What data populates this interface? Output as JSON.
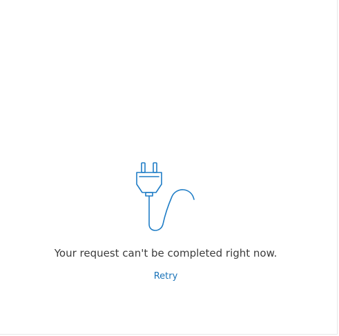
{
  "error_state": {
    "illustration_icon": "unplugged-cable-icon",
    "message": "Your request can't be completed right now.",
    "retry_label": "Retry"
  },
  "colors": {
    "accent": "#1a73b8",
    "icon_stroke": "#1f7dc6",
    "message_text": "#3b3b3b",
    "background": "#ffffff"
  }
}
